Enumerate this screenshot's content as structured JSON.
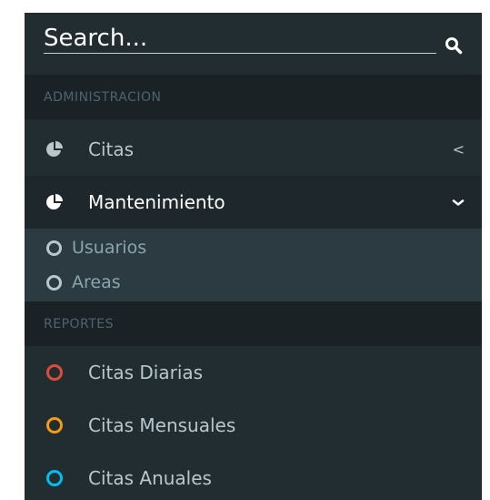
{
  "search": {
    "placeholder": "Search..."
  },
  "icons": {
    "search": "search-icon",
    "pie": "pie-chart-icon",
    "circle": "circle-outline-icon"
  },
  "colors": {
    "sidebar_bg": "#222d32",
    "header_bg": "#1a2226",
    "active_bg": "#1e282c",
    "submenu_bg": "#2c3b41",
    "red": "#dd4b39",
    "yellow": "#f39c12",
    "aqua": "#00c0ef"
  },
  "menu": {
    "header_admin": "ADMINISTRACION",
    "citas": {
      "label": "Citas",
      "arrow": "<"
    },
    "mantenimiento": {
      "label": "Mantenimiento",
      "arrow": "⌄",
      "children": [
        {
          "label": "Usuarios"
        },
        {
          "label": "Areas"
        }
      ]
    },
    "header_reportes": "REPORTES",
    "reports": [
      {
        "label": "Citas Diarias",
        "color": "red"
      },
      {
        "label": "Citas Mensuales",
        "color": "yellow"
      },
      {
        "label": "Citas Anuales",
        "color": "aqua"
      }
    ]
  }
}
